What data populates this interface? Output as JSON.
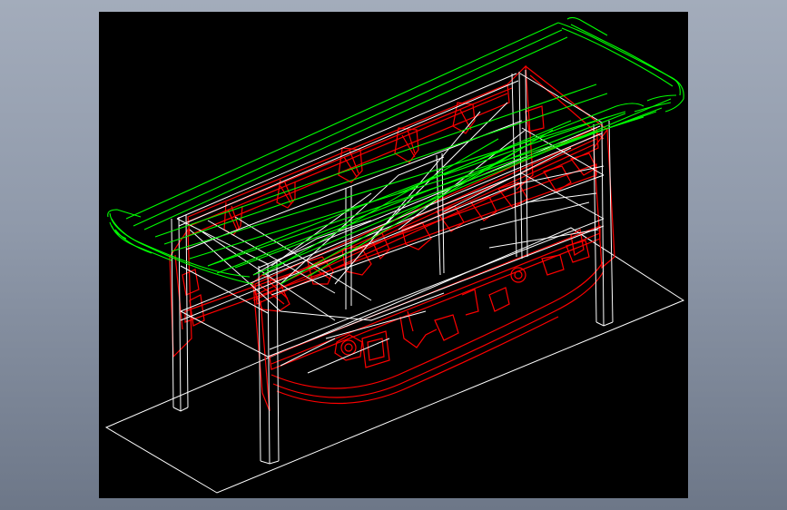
{
  "viewport": {
    "background": "#000000",
    "page_background": "#98a2b2"
  },
  "model": {
    "colors": {
      "top": "#00ff00",
      "carving": "#ff0000",
      "frame": "#ffffff",
      "ground": "#ffffff"
    },
    "icon": "cad-wireframe-altar-table"
  }
}
